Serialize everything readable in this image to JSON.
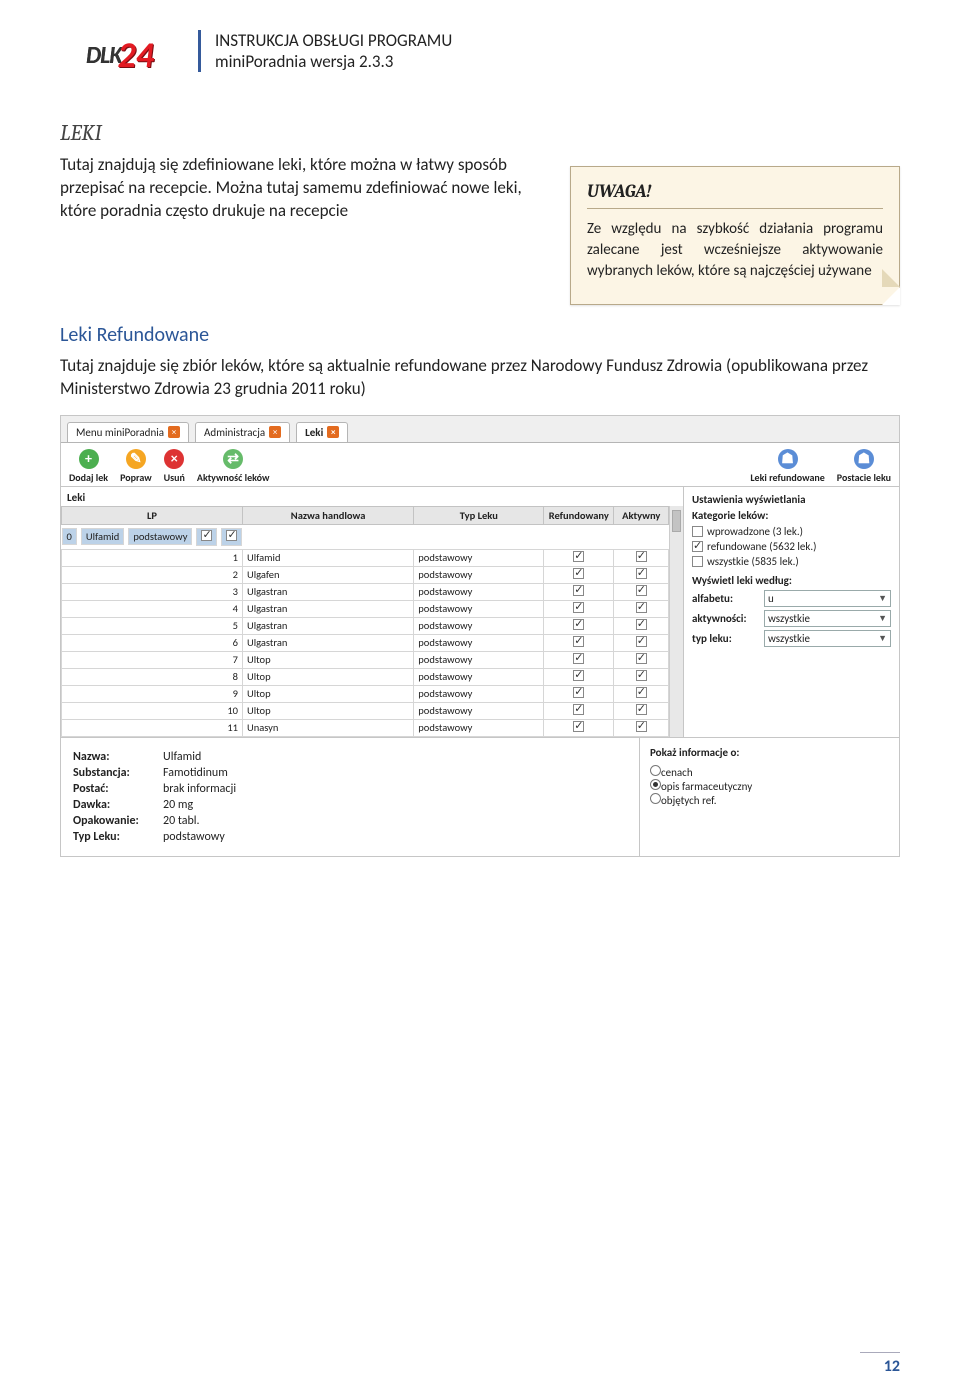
{
  "header": {
    "line1": "INSTRUKCJA OBSŁUGI PROGRAMU",
    "line2": "miniPoradnia wersja 2.3.3",
    "logo_text": "DLK",
    "logo_num": "24"
  },
  "section": {
    "title": "LEKI",
    "para1": "Tutaj znajdują się zdefiniowane leki, które można w łatwy sposób przepisać na recepcie. Można tutaj samemu zdefiniować nowe leki, które poradnia często drukuje na recepcie",
    "callout_title": "UWAGA!",
    "callout_body": "Ze względu na szybkość działania programu zalecane jest wcześniejsze aktywowanie wybranych leków, które są najczęściej używane"
  },
  "subsection": {
    "title": "Leki Refundowane",
    "para": "Tutaj znajduje się zbiór leków, które są aktualnie refundowane przez Narodowy Fundusz Zdrowia (opublikowana przez Ministerstwo Zdrowia 23 grudnia 2011 roku)"
  },
  "app": {
    "tabs": [
      "Menu miniPoradnia",
      "Administracja",
      "Leki"
    ],
    "toolbar": {
      "add": "Dodaj lek",
      "edit": "Popraw",
      "del": "Usuń",
      "act": "Aktywność leków",
      "refund": "Leki refundowane",
      "form": "Postacie leku"
    },
    "panel_title": "Leki",
    "columns": [
      "LP",
      "Nazwa handlowa",
      "Typ Leku",
      "Refundowany",
      "Aktywny"
    ],
    "rows": [
      {
        "lp": "0",
        "name": "Ulfamid",
        "type": "podstawowy",
        "ref": true,
        "act": true,
        "sel": true
      },
      {
        "lp": "1",
        "name": "Ulfamid",
        "type": "podstawowy",
        "ref": true,
        "act": true
      },
      {
        "lp": "2",
        "name": "Ulgafen",
        "type": "podstawowy",
        "ref": true,
        "act": true
      },
      {
        "lp": "3",
        "name": "Ulgastran",
        "type": "podstawowy",
        "ref": true,
        "act": true
      },
      {
        "lp": "4",
        "name": "Ulgastran",
        "type": "podstawowy",
        "ref": true,
        "act": true
      },
      {
        "lp": "5",
        "name": "Ulgastran",
        "type": "podstawowy",
        "ref": true,
        "act": true
      },
      {
        "lp": "6",
        "name": "Ulgastran",
        "type": "podstawowy",
        "ref": true,
        "act": true
      },
      {
        "lp": "7",
        "name": "Ultop",
        "type": "podstawowy",
        "ref": true,
        "act": true
      },
      {
        "lp": "8",
        "name": "Ultop",
        "type": "podstawowy",
        "ref": true,
        "act": true
      },
      {
        "lp": "9",
        "name": "Ultop",
        "type": "podstawowy",
        "ref": true,
        "act": true
      },
      {
        "lp": "10",
        "name": "Ultop",
        "type": "podstawowy",
        "ref": true,
        "act": true
      },
      {
        "lp": "11",
        "name": "Unasyn",
        "type": "podstawowy",
        "ref": true,
        "act": true
      }
    ],
    "right": {
      "title": "Ustawienia wyświetlania",
      "group_label": "Kategorie leków:",
      "opt_intro": "wprowadzone (3 lek.)",
      "opt_refund": "refundowane (5632 lek.)",
      "opt_all": "wszystkie (5835 lek.)",
      "display_label": "Wyświetl leki według:",
      "alpha_label": "alfabetu:",
      "alpha_value": "u",
      "act_label": "aktywności:",
      "act_value": "wszystkie",
      "type_label": "typ leku:",
      "type_value": "wszystkie"
    },
    "details": {
      "name_l": "Nazwa:",
      "name_v": "Ulfamid",
      "sub_l": "Substancja:",
      "sub_v": "Famotidinum",
      "form_l": "Postać:",
      "form_v": "brak informacji",
      "dose_l": "Dawka:",
      "dose_v": "20 mg",
      "pack_l": "Opakowanie:",
      "pack_v": "20 tabl.",
      "type_l": "Typ Leku:",
      "type_v": "podstawowy"
    },
    "info": {
      "title": "Pokaż informacje o:",
      "r1": "cenach",
      "r2": "opis farmaceutyczny",
      "r3": "objętych ref."
    }
  },
  "footer": {
    "page": "12"
  }
}
